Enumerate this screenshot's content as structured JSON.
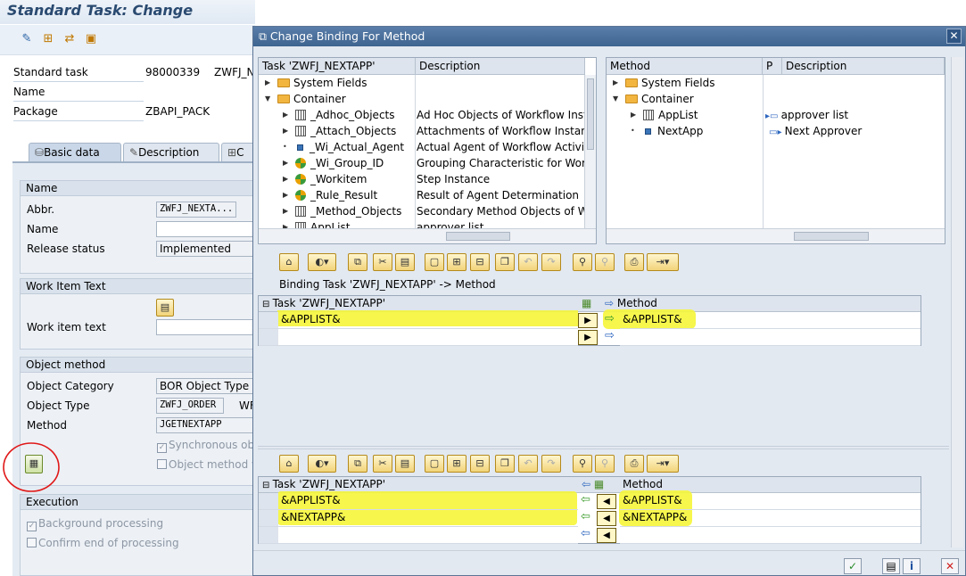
{
  "main": {
    "title": "Standard Task: Change",
    "toolbar_icons": [
      "glasses-icon",
      "hierarchy-icon",
      "transport-icon",
      "clipboard-icon"
    ],
    "fields": {
      "standard_task_label": "Standard task",
      "standard_task_value": "98000339",
      "standard_task_abbr": "ZWFJ_N",
      "name_label": "Name",
      "package_label": "Package",
      "package_value": "ZBAPI_PACK"
    },
    "tabs": [
      "Basic data",
      "Description",
      "C"
    ],
    "name_group": {
      "title": "Name",
      "abbr_label": "Abbr.",
      "abbr_value": "ZWFJ_NEXTA...",
      "name_label": "Name",
      "name_value": "",
      "release_label": "Release status",
      "release_value": "Implemented"
    },
    "work_item_group": {
      "title": "Work Item Text",
      "text_label": "Work item text",
      "text_value": ""
    },
    "object_method_group": {
      "title": "Object method",
      "category_label": "Object Category",
      "category_value": "BOR Object Type",
      "type_label": "Object Type",
      "type_value": "ZWFJ_ORDER",
      "type_suffix": "WF",
      "method_label": "Method",
      "method_value": "JGETNEXTAPP",
      "sync_label": "Synchronous obj",
      "objmethod_label": "Object method w"
    },
    "execution_group": {
      "title": "Execution",
      "background_label": "Background processing",
      "confirm_label": "Confirm end of processing"
    }
  },
  "dialog": {
    "title": "Change Binding For Method",
    "left_tree": {
      "col_task": "Task 'ZWFJ_NEXTAPP'",
      "col_desc": "Description",
      "rows": [
        {
          "name": "System Fields",
          "desc": ""
        },
        {
          "name": "Container",
          "desc": ""
        },
        {
          "name": "_Adhoc_Objects",
          "desc": "Ad Hoc Objects of Workflow Insta"
        },
        {
          "name": "_Attach_Objects",
          "desc": "Attachments of Workflow Instanc"
        },
        {
          "name": "_Wi_Actual_Agent",
          "desc": "Actual Agent of Workflow Activity"
        },
        {
          "name": "_Wi_Group_ID",
          "desc": "Grouping Characteristic for Workflo"
        },
        {
          "name": "_Workitem",
          "desc": "Step Instance"
        },
        {
          "name": "_Rule_Result",
          "desc": "Result of Agent Determination"
        },
        {
          "name": "_Method_Objects",
          "desc": "Secondary Method Objects of Wo"
        },
        {
          "name": "AppList",
          "desc": "approver list"
        }
      ]
    },
    "right_tree": {
      "col_method": "Method",
      "col_p": "P",
      "col_desc": "Description",
      "rows": [
        {
          "name": "System Fields",
          "desc": ""
        },
        {
          "name": "Container",
          "desc": ""
        },
        {
          "name": "AppList",
          "desc": "approver list"
        },
        {
          "name": "NextApp",
          "desc": "Next Approver"
        }
      ]
    },
    "binding_title": "Binding Task 'ZWFJ_NEXTAPP' -> Method",
    "upper_grid": {
      "col_task": "Task 'ZWFJ_NEXTAPP'",
      "col_method": "Method",
      "rows": [
        {
          "task": "&APPLIST&",
          "method": "&APPLIST&"
        },
        {
          "task": "",
          "method": ""
        }
      ]
    },
    "lower_grid": {
      "col_task": "Task 'ZWFJ_NEXTAPP'",
      "col_method": "Method",
      "rows": [
        {
          "task": "&APPLIST&",
          "method": "&APPLIST&"
        },
        {
          "task": "&NEXTAPP&",
          "method": "&NEXTAPP&"
        },
        {
          "task": "",
          "method": ""
        }
      ]
    }
  }
}
